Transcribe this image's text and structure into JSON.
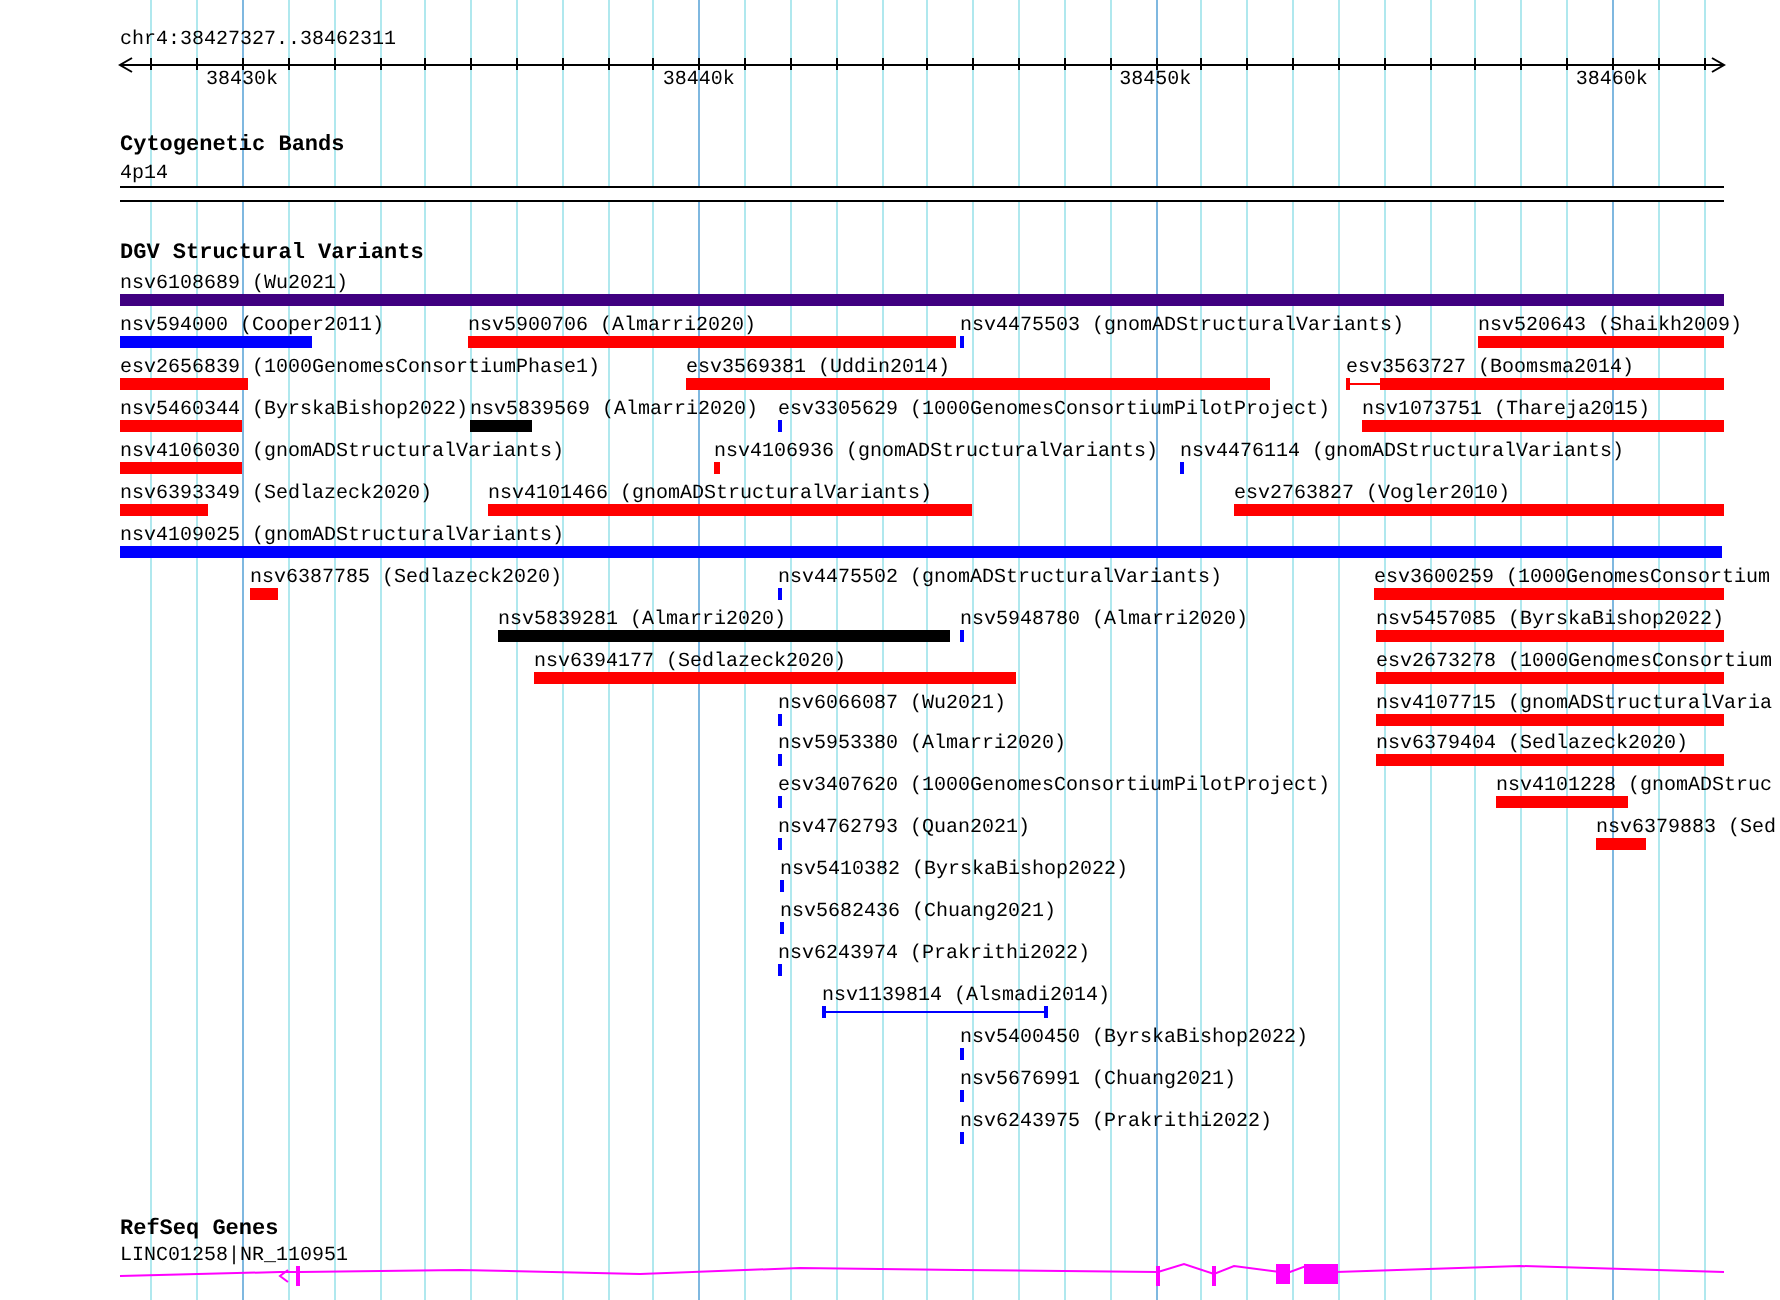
{
  "location": "chr4:38427327..38462311",
  "ruler": {
    "labels": [
      "38430k",
      "38440k",
      "38450k",
      "38460k"
    ]
  },
  "tracks": [
    {
      "kind": "bands",
      "title": "Cytogenetic Bands",
      "bands": [
        {
          "label": "4p14"
        }
      ]
    },
    {
      "kind": "variants",
      "title": "DGV Structural Variants",
      "rows": [
        {
          "features": [
            {
              "label": "nsv6108689 (Wu2021)",
              "color": "#400080",
              "kind": "bar"
            }
          ]
        },
        {
          "features": [
            {
              "label": "nsv594000 (Cooper2011)",
              "color": "#0000ff",
              "kind": "bar"
            },
            {
              "label": "nsv5900706 (Almarri2020)",
              "color": "#ff0000",
              "kind": "bar"
            },
            {
              "label": "nsv4475503 (gnomADStructuralVariants)",
              "color": "#0000ff",
              "kind": "bar"
            },
            {
              "label": "nsv520643 (Shaikh2009)",
              "color": "#ff0000",
              "kind": "bar"
            }
          ]
        },
        {
          "features": [
            {
              "label": "esv2656839 (1000GenomesConsortiumPhase1)",
              "color": "#ff0000",
              "kind": "bar"
            },
            {
              "label": "esv3569381 (Uddin2014)",
              "color": "#ff0000",
              "kind": "bar"
            },
            {
              "label": "esv3563727 (Boomsma2014)",
              "color": "#ff0000",
              "kind": "span"
            }
          ]
        },
        {
          "features": [
            {
              "label": "nsv5460344 (ByrskaBishop2022)",
              "color": "#ff0000",
              "kind": "bar"
            },
            {
              "label": "nsv5839569 (Almarri2020)",
              "color": "#000000",
              "kind": "bar"
            },
            {
              "label": "esv3305629 (1000GenomesConsortiumPilotProject)",
              "color": "#0000ff",
              "kind": "bar"
            },
            {
              "label": "nsv1073751 (Thareja2015)",
              "color": "#ff0000",
              "kind": "bar"
            }
          ]
        },
        {
          "features": [
            {
              "label": "nsv4106030 (gnomADStructuralVariants)",
              "color": "#ff0000",
              "kind": "bar"
            },
            {
              "label": "nsv4106936 (gnomADStructuralVariants)",
              "color": "#ff0000",
              "kind": "bar"
            },
            {
              "label": "nsv4476114 (gnomADStructuralVariants)",
              "color": "#0000ff",
              "kind": "bar"
            }
          ]
        },
        {
          "features": [
            {
              "label": "nsv6393349 (Sedlazeck2020)",
              "color": "#ff0000",
              "kind": "bar"
            },
            {
              "label": "nsv4101466 (gnomADStructuralVariants)",
              "color": "#ff0000",
              "kind": "bar"
            },
            {
              "label": "esv2763827 (Vogler2010)",
              "color": "#ff0000",
              "kind": "bar"
            }
          ]
        },
        {
          "features": [
            {
              "label": "nsv4109025 (gnomADStructuralVariants)",
              "color": "#0000ff",
              "kind": "bar"
            }
          ]
        },
        {
          "features": [
            {
              "label": "nsv6387785 (Sedlazeck2020)",
              "color": "#ff0000",
              "kind": "bar"
            },
            {
              "label": "nsv4475502 (gnomADStructuralVariants)",
              "color": "#0000ff",
              "kind": "bar"
            },
            {
              "label": "esv3600259 (1000GenomesConsortium",
              "color": "#ff0000",
              "kind": "bar"
            }
          ]
        },
        {
          "features": [
            {
              "label": "nsv5839281 (Almarri2020)",
              "color": "#000000",
              "kind": "bar"
            },
            {
              "label": "nsv5948780 (Almarri2020)",
              "color": "#0000ff",
              "kind": "bar"
            },
            {
              "label": "nsv5457085 (ByrskaBishop2022)",
              "color": "#ff0000",
              "kind": "bar"
            }
          ]
        },
        {
          "features": [
            {
              "label": "nsv6394177 (Sedlazeck2020)",
              "color": "#ff0000",
              "kind": "bar"
            },
            {
              "label": "esv2673278 (1000GenomesConsortium",
              "color": "#ff0000",
              "kind": "bar"
            }
          ]
        },
        {
          "features": [
            {
              "label": "nsv6066087 (Wu2021)",
              "color": "#0000ff",
              "kind": "bar"
            },
            {
              "label": "nsv4107715 (gnomADStructuralVaria",
              "color": "#ff0000",
              "kind": "bar"
            }
          ]
        },
        {
          "features": [
            {
              "label": "nsv5953380 (Almarri2020)",
              "color": "#0000ff",
              "kind": "bar"
            },
            {
              "label": "nsv6379404 (Sedlazeck2020)",
              "color": "#ff0000",
              "kind": "bar"
            }
          ]
        },
        {
          "features": [
            {
              "label": "esv3407620 (1000GenomesConsortiumPilotProject)",
              "color": "#0000ff",
              "kind": "bar"
            },
            {
              "label": "nsv4101228 (gnomADStruc",
              "color": "#ff0000",
              "kind": "bar"
            }
          ]
        },
        {
          "features": [
            {
              "label": "nsv4762793 (Quan2021)",
              "color": "#0000ff",
              "kind": "bar"
            },
            {
              "label": "nsv6379883 (Sed",
              "color": "#ff0000",
              "kind": "bar"
            }
          ]
        },
        {
          "features": [
            {
              "label": "nsv5410382 (ByrskaBishop2022)",
              "color": "#0000ff",
              "kind": "bar"
            }
          ]
        },
        {
          "features": [
            {
              "label": "nsv5682436 (Chuang2021)",
              "color": "#0000ff",
              "kind": "bar"
            }
          ]
        },
        {
          "features": [
            {
              "label": "nsv6243974 (Prakrithi2022)",
              "color": "#0000ff",
              "kind": "bar"
            }
          ]
        },
        {
          "features": [
            {
              "label": "nsv1139814 (Alsmadi2014)",
              "color": "#0000ff",
              "kind": "span"
            }
          ]
        },
        {
          "features": [
            {
              "label": "nsv5400450 (ByrskaBishop2022)",
              "color": "#0000ff",
              "kind": "bar"
            }
          ]
        },
        {
          "features": [
            {
              "label": "nsv5676991 (Chuang2021)",
              "color": "#0000ff",
              "kind": "bar"
            }
          ]
        },
        {
          "features": [
            {
              "label": "nsv6243975 (Prakrithi2022)",
              "color": "#0000ff",
              "kind": "bar"
            }
          ]
        }
      ]
    },
    {
      "kind": "genes",
      "title": "RefSeq Genes",
      "genes": [
        {
          "label": "LINC01258|NR_110951"
        }
      ]
    }
  ]
}
